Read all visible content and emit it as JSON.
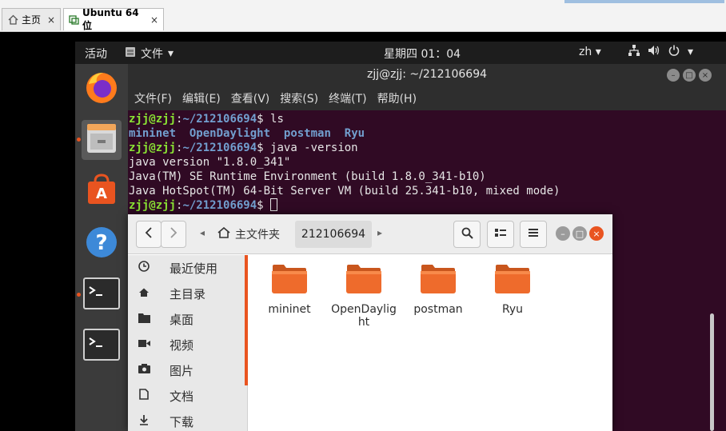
{
  "host": {
    "tabs": [
      {
        "label": "主页",
        "icon": "home-icon"
      },
      {
        "label": "Ubuntu 64 位",
        "icon": "vm-icon"
      }
    ],
    "close_glyph": "×"
  },
  "topbar": {
    "activities": "活动",
    "app_menu": "文件",
    "clock": "星期四 01：04",
    "lang": "zh",
    "dropdown_glyph": "▾"
  },
  "terminal": {
    "title": "zjj@zjj: ~/212106694",
    "menu": [
      "文件(F)",
      "编辑(E)",
      "查看(V)",
      "搜索(S)",
      "终端(T)",
      "帮助(H)"
    ],
    "prompt_user": "zjj@zjj",
    "prompt_sep": ":",
    "prompt_path": "~/212106694",
    "prompt_end": "$ ",
    "cmd1": "ls",
    "ls_dirs": [
      "mininet",
      "OpenDaylight",
      "postman",
      "Ryu"
    ],
    "cmd2": "java -version",
    "output": [
      "java version \"1.8.0_341\"",
      "Java(TM) SE Runtime Environment (build 1.8.0_341-b10)",
      "Java HotSpot(TM) 64-Bit Server VM (build 25.341-b10, mixed mode)"
    ]
  },
  "files": {
    "breadcrumb_home": "主文件夹",
    "breadcrumb_current": "212106694",
    "sidebar": [
      {
        "label": "最近使用",
        "icon": "clock-icon"
      },
      {
        "label": "主目录",
        "icon": "home-icon"
      },
      {
        "label": "桌面",
        "icon": "folder-icon"
      },
      {
        "label": "视频",
        "icon": "video-icon"
      },
      {
        "label": "图片",
        "icon": "camera-icon"
      },
      {
        "label": "文档",
        "icon": "document-icon"
      },
      {
        "label": "下载",
        "icon": "download-icon"
      }
    ],
    "folders": [
      "mininet",
      "OpenDaylight",
      "postman",
      "Ryu"
    ]
  },
  "colors": {
    "ubuntu_orange": "#e95420",
    "terminal_bg": "#300a24",
    "prompt_green": "#8ae234",
    "dir_blue": "#729fcf"
  }
}
